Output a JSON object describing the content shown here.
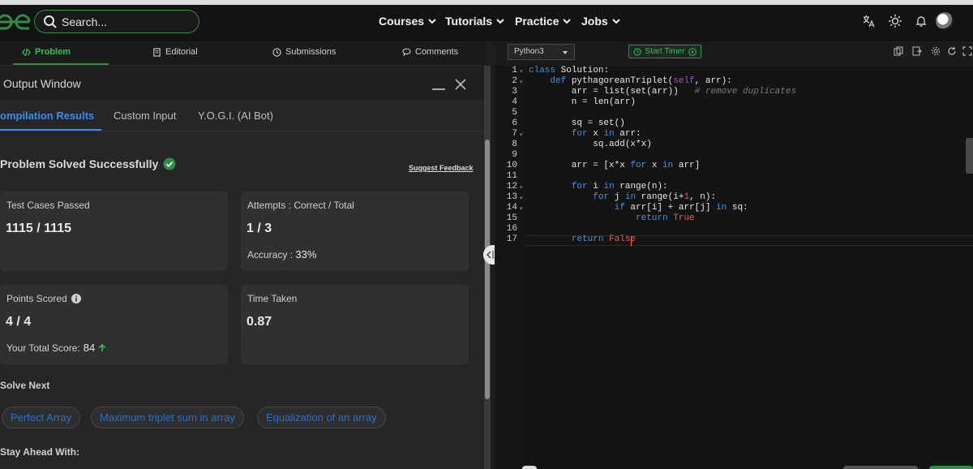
{
  "header": {
    "search_placeholder": "Search...",
    "nav": [
      "Courses",
      "Tutorials",
      "Practice",
      "Jobs"
    ]
  },
  "problem_tabs": [
    {
      "label": "Problem",
      "icon": "code-icon",
      "active": true
    },
    {
      "label": "Editorial",
      "icon": "document-icon"
    },
    {
      "label": "Submissions",
      "icon": "clock-icon"
    },
    {
      "label": "Comments",
      "icon": "comment-icon"
    }
  ],
  "output_window": {
    "title": "Output Window",
    "tabs": [
      "ompilation Results",
      "Custom Input",
      "Y.O.G.I. (AI Bot)"
    ],
    "status": "Problem Solved Successfully",
    "suggest_feedback": "Suggest Feedback",
    "test_cases": {
      "label": "Test Cases Passed",
      "value": "1115 / 1115"
    },
    "attempts": {
      "label": "Attempts : Correct / Total",
      "value": "1 / 3",
      "accuracy_label": "Accuracy :",
      "accuracy_value": "33%"
    },
    "points": {
      "label": "Points Scored",
      "value": "4 / 4",
      "total_label": "Your Total Score:",
      "total_value": "84"
    },
    "time": {
      "label": "Time Taken",
      "value": "0.87"
    },
    "solve_next_title": "Solve Next",
    "solve_next": [
      "Perfect Array",
      "Maximum triplet sum in array",
      "Equalization of an array"
    ],
    "stay_ahead": "Stay Ahead With:"
  },
  "editor": {
    "language": "Python3",
    "timer_label": "Start Timer"
  },
  "colors": {
    "accent_green": "#2f8d46",
    "link_blue": "#3c8cf0",
    "keyword": "#4d8fd6"
  }
}
